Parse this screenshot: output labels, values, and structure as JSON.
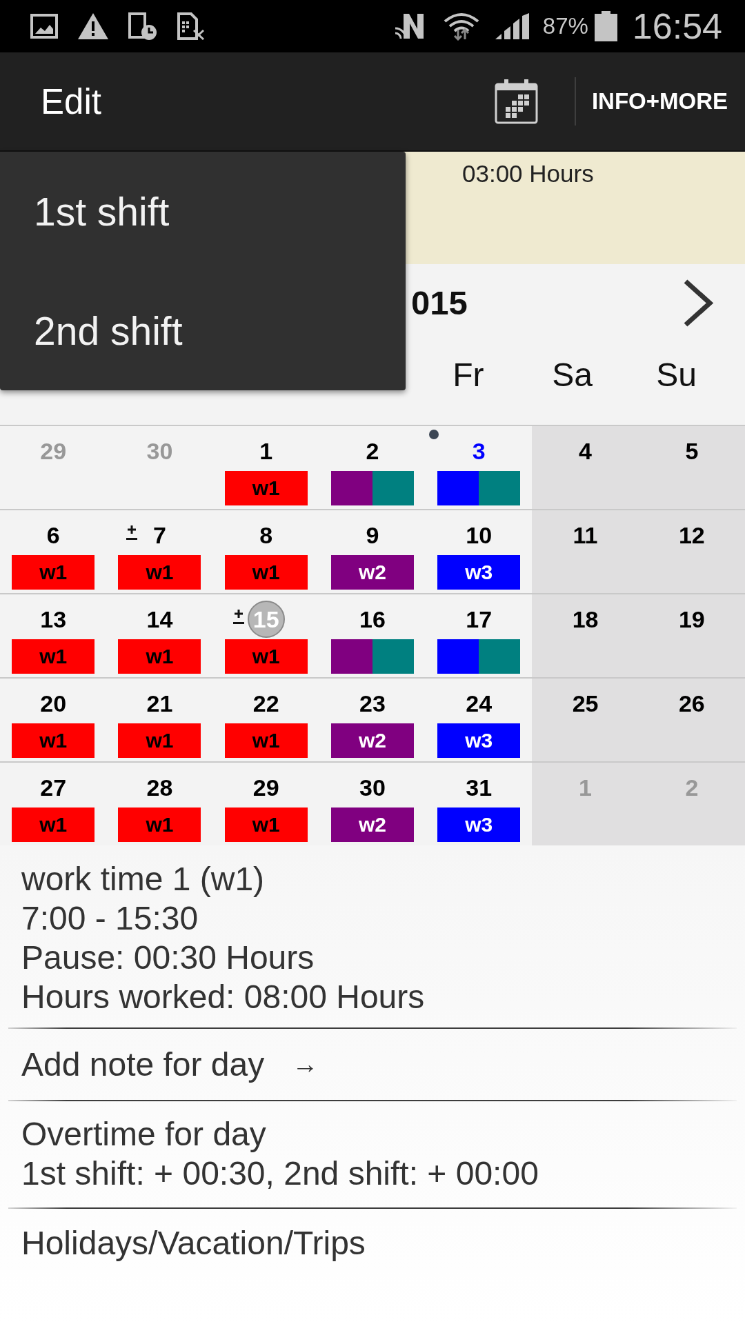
{
  "status_bar": {
    "battery": "87%",
    "time": "16:54"
  },
  "app_bar": {
    "title": "Edit",
    "action": "INFO+MORE"
  },
  "dropdown": {
    "items": [
      {
        "label": "1st shift"
      },
      {
        "label": "2nd shift"
      }
    ]
  },
  "summary": {
    "hours": "03:00 Hours"
  },
  "month_header": {
    "title": "015"
  },
  "weekdays": [
    {
      "label": "Fr"
    },
    {
      "label": "Sa"
    },
    {
      "label": "Su"
    }
  ],
  "weeks": [
    {
      "days": [
        {
          "label": "29",
          "outside": true,
          "weekend": false,
          "today": false,
          "selected": false,
          "overtime": false,
          "dot": false
        },
        {
          "label": "30",
          "outside": true,
          "weekend": false,
          "today": false,
          "selected": false,
          "overtime": false,
          "dot": false
        },
        {
          "label": "1",
          "outside": false,
          "weekend": false,
          "today": false,
          "selected": false,
          "overtime": false,
          "dot": false,
          "shifts": [
            {
              "label": "w1",
              "color": "#ff0000"
            }
          ]
        },
        {
          "label": "2",
          "outside": false,
          "weekend": false,
          "today": false,
          "selected": false,
          "overtime": false,
          "dot": false,
          "shifts": [
            {
              "color": "#800080"
            },
            {
              "color": "#008080"
            }
          ]
        },
        {
          "label": "3",
          "outside": false,
          "weekend": false,
          "today": true,
          "selected": false,
          "overtime": false,
          "dot": true,
          "shifts": [
            {
              "color": "#0000ff"
            },
            {
              "color": "#008080"
            }
          ]
        },
        {
          "label": "4",
          "outside": false,
          "weekend": true,
          "today": false,
          "selected": false,
          "overtime": false,
          "dot": false
        },
        {
          "label": "5",
          "outside": false,
          "weekend": true,
          "today": false,
          "selected": false,
          "overtime": false,
          "dot": false
        }
      ]
    },
    {
      "days": [
        {
          "label": "6",
          "outside": false,
          "weekend": false,
          "today": false,
          "selected": false,
          "overtime": false,
          "dot": false,
          "shifts": [
            {
              "label": "w1",
              "color": "#ff0000"
            }
          ]
        },
        {
          "label": "7",
          "outside": false,
          "weekend": false,
          "today": false,
          "selected": false,
          "overtime": true,
          "dot": false,
          "shifts": [
            {
              "label": "w1",
              "color": "#ff0000"
            }
          ]
        },
        {
          "label": "8",
          "outside": false,
          "weekend": false,
          "today": false,
          "selected": false,
          "overtime": false,
          "dot": false,
          "shifts": [
            {
              "label": "w1",
              "color": "#ff0000"
            }
          ]
        },
        {
          "label": "9",
          "outside": false,
          "weekend": false,
          "today": false,
          "selected": false,
          "overtime": false,
          "dot": false,
          "shifts": [
            {
              "label": "w2",
              "color": "#800080"
            }
          ]
        },
        {
          "label": "10",
          "outside": false,
          "weekend": false,
          "today": false,
          "selected": false,
          "overtime": false,
          "dot": false,
          "shifts": [
            {
              "label": "w3",
              "color": "#0000ff"
            }
          ]
        },
        {
          "label": "11",
          "outside": false,
          "weekend": true,
          "today": false,
          "selected": false,
          "overtime": false,
          "dot": false
        },
        {
          "label": "12",
          "outside": false,
          "weekend": true,
          "today": false,
          "selected": false,
          "overtime": false,
          "dot": false
        }
      ]
    },
    {
      "days": [
        {
          "label": "13",
          "outside": false,
          "weekend": false,
          "today": false,
          "selected": false,
          "overtime": false,
          "dot": false,
          "shifts": [
            {
              "label": "w1",
              "color": "#ff0000"
            }
          ]
        },
        {
          "label": "14",
          "outside": false,
          "weekend": false,
          "today": false,
          "selected": false,
          "overtime": false,
          "dot": false,
          "shifts": [
            {
              "label": "w1",
              "color": "#ff0000"
            }
          ]
        },
        {
          "label": "15",
          "outside": false,
          "weekend": false,
          "today": false,
          "selected": true,
          "overtime": true,
          "dot": false,
          "shifts": [
            {
              "label": "w1",
              "color": "#ff0000"
            }
          ]
        },
        {
          "label": "16",
          "outside": false,
          "weekend": false,
          "today": false,
          "selected": false,
          "overtime": false,
          "dot": false,
          "shifts": [
            {
              "color": "#800080"
            },
            {
              "color": "#008080"
            }
          ]
        },
        {
          "label": "17",
          "outside": false,
          "weekend": false,
          "today": false,
          "selected": false,
          "overtime": false,
          "dot": false,
          "shifts": [
            {
              "color": "#0000ff"
            },
            {
              "color": "#008080"
            }
          ]
        },
        {
          "label": "18",
          "outside": false,
          "weekend": true,
          "today": false,
          "selected": false,
          "overtime": false,
          "dot": false
        },
        {
          "label": "19",
          "outside": false,
          "weekend": true,
          "today": false,
          "selected": false,
          "overtime": false,
          "dot": false
        }
      ]
    },
    {
      "days": [
        {
          "label": "20",
          "outside": false,
          "weekend": false,
          "today": false,
          "selected": false,
          "overtime": false,
          "dot": false,
          "shifts": [
            {
              "label": "w1",
              "color": "#ff0000"
            }
          ]
        },
        {
          "label": "21",
          "outside": false,
          "weekend": false,
          "today": false,
          "selected": false,
          "overtime": false,
          "dot": false,
          "shifts": [
            {
              "label": "w1",
              "color": "#ff0000"
            }
          ]
        },
        {
          "label": "22",
          "outside": false,
          "weekend": false,
          "today": false,
          "selected": false,
          "overtime": false,
          "dot": false,
          "shifts": [
            {
              "label": "w1",
              "color": "#ff0000"
            }
          ]
        },
        {
          "label": "23",
          "outside": false,
          "weekend": false,
          "today": false,
          "selected": false,
          "overtime": false,
          "dot": false,
          "shifts": [
            {
              "label": "w2",
              "color": "#800080"
            }
          ]
        },
        {
          "label": "24",
          "outside": false,
          "weekend": false,
          "today": false,
          "selected": false,
          "overtime": false,
          "dot": false,
          "shifts": [
            {
              "label": "w3",
              "color": "#0000ff"
            }
          ]
        },
        {
          "label": "25",
          "outside": false,
          "weekend": true,
          "today": false,
          "selected": false,
          "overtime": false,
          "dot": false
        },
        {
          "label": "26",
          "outside": false,
          "weekend": true,
          "today": false,
          "selected": false,
          "overtime": false,
          "dot": false
        }
      ]
    },
    {
      "days": [
        {
          "label": "27",
          "outside": false,
          "weekend": false,
          "today": false,
          "selected": false,
          "overtime": false,
          "dot": false,
          "shifts": [
            {
              "label": "w1",
              "color": "#ff0000"
            }
          ]
        },
        {
          "label": "28",
          "outside": false,
          "weekend": false,
          "today": false,
          "selected": false,
          "overtime": false,
          "dot": false,
          "shifts": [
            {
              "label": "w1",
              "color": "#ff0000"
            }
          ]
        },
        {
          "label": "29",
          "outside": false,
          "weekend": false,
          "today": false,
          "selected": false,
          "overtime": false,
          "dot": false,
          "shifts": [
            {
              "label": "w1",
              "color": "#ff0000"
            }
          ]
        },
        {
          "label": "30",
          "outside": false,
          "weekend": false,
          "today": false,
          "selected": false,
          "overtime": false,
          "dot": false,
          "shifts": [
            {
              "label": "w2",
              "color": "#800080"
            }
          ]
        },
        {
          "label": "31",
          "outside": false,
          "weekend": false,
          "today": false,
          "selected": false,
          "overtime": false,
          "dot": false,
          "shifts": [
            {
              "label": "w3",
              "color": "#0000ff"
            }
          ]
        },
        {
          "label": "1",
          "outside": true,
          "weekend": true,
          "today": false,
          "selected": false,
          "overtime": false,
          "dot": false
        },
        {
          "label": "2",
          "outside": true,
          "weekend": true,
          "today": false,
          "selected": false,
          "overtime": false,
          "dot": false
        }
      ]
    }
  ],
  "details": {
    "lines": [
      "work time 1 (w1)",
      "7:00 - 15:30",
      "Pause: 00:30 Hours",
      "Hours worked: 08:00 Hours"
    ]
  },
  "note_link": {
    "label": "Add note for day",
    "arrow": "→"
  },
  "overtime": {
    "title": "Overtime for day",
    "value": "1st shift: + 00:30, 2nd shift: + 00:00"
  },
  "holidays": {
    "label": "Holidays/Vacation/Trips"
  }
}
